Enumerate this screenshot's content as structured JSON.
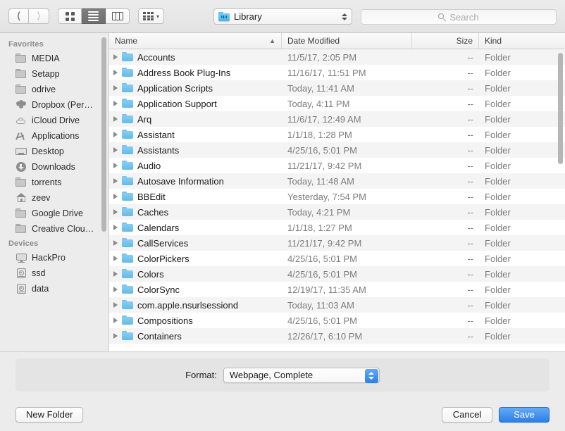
{
  "toolbar": {
    "back_icon": "chevron-left-icon",
    "forward_icon": "chevron-right-icon",
    "view_icon_label": "icon-view",
    "view_list_label": "list-view",
    "view_column_label": "column-view",
    "arrange_label": "arrange-by",
    "path_label": "Library",
    "search_placeholder": "Search",
    "search_value": ""
  },
  "sidebar": {
    "sections": [
      {
        "title": "Favorites",
        "items": [
          {
            "label": "MEDIA",
            "icon": "folder-icon"
          },
          {
            "label": "Setapp",
            "icon": "folder-icon"
          },
          {
            "label": "odrive",
            "icon": "folder-icon"
          },
          {
            "label": "Dropbox (Per…",
            "icon": "dropbox-icon"
          },
          {
            "label": "iCloud Drive",
            "icon": "cloud-icon"
          },
          {
            "label": "Applications",
            "icon": "applications-icon"
          },
          {
            "label": "Desktop",
            "icon": "desktop-icon"
          },
          {
            "label": "Downloads",
            "icon": "downloads-icon"
          },
          {
            "label": "torrents",
            "icon": "folder-icon"
          },
          {
            "label": "zeev",
            "icon": "home-icon"
          },
          {
            "label": "Google Drive",
            "icon": "folder-icon"
          },
          {
            "label": "Creative Clou…",
            "icon": "folder-icon"
          }
        ]
      },
      {
        "title": "Devices",
        "items": [
          {
            "label": "HackPro",
            "icon": "display-icon"
          },
          {
            "label": "ssd",
            "icon": "harddisk-icon"
          },
          {
            "label": "data",
            "icon": "harddisk-icon"
          }
        ]
      }
    ]
  },
  "filelist": {
    "columns": {
      "name": "Name",
      "date_modified": "Date Modified",
      "size": "Size",
      "kind": "Kind"
    },
    "sort_column": "Name",
    "sort_direction": "ascending",
    "sort_glyph": "▲",
    "rows": [
      {
        "name": "Accounts",
        "date": "11/5/17, 2:05 PM",
        "size": "--",
        "kind": "Folder"
      },
      {
        "name": "Address Book Plug-Ins",
        "date": "11/16/17, 11:51 PM",
        "size": "--",
        "kind": "Folder"
      },
      {
        "name": "Application Scripts",
        "date": "Today, 11:41 AM",
        "size": "--",
        "kind": "Folder"
      },
      {
        "name": "Application Support",
        "date": "Today, 4:11 PM",
        "size": "--",
        "kind": "Folder"
      },
      {
        "name": "Arq",
        "date": "11/6/17, 12:49 AM",
        "size": "--",
        "kind": "Folder"
      },
      {
        "name": "Assistant",
        "date": "1/1/18, 1:28 PM",
        "size": "--",
        "kind": "Folder"
      },
      {
        "name": "Assistants",
        "date": "4/25/16, 5:01 PM",
        "size": "--",
        "kind": "Folder"
      },
      {
        "name": "Audio",
        "date": "11/21/17, 9:42 PM",
        "size": "--",
        "kind": "Folder"
      },
      {
        "name": "Autosave Information",
        "date": "Today, 11:48 AM",
        "size": "--",
        "kind": "Folder"
      },
      {
        "name": "BBEdit",
        "date": "Yesterday, 7:54 PM",
        "size": "--",
        "kind": "Folder"
      },
      {
        "name": "Caches",
        "date": "Today, 4:21 PM",
        "size": "--",
        "kind": "Folder"
      },
      {
        "name": "Calendars",
        "date": "1/1/18, 1:27 PM",
        "size": "--",
        "kind": "Folder"
      },
      {
        "name": "CallServices",
        "date": "11/21/17, 9:42 PM",
        "size": "--",
        "kind": "Folder"
      },
      {
        "name": "ColorPickers",
        "date": "4/25/16, 5:01 PM",
        "size": "--",
        "kind": "Folder"
      },
      {
        "name": "Colors",
        "date": "4/25/16, 5:01 PM",
        "size": "--",
        "kind": "Folder"
      },
      {
        "name": "ColorSync",
        "date": "12/19/17, 11:35 AM",
        "size": "--",
        "kind": "Folder"
      },
      {
        "name": "com.apple.nsurlsessiond",
        "date": "Today, 11:03 AM",
        "size": "--",
        "kind": "Folder"
      },
      {
        "name": "Compositions",
        "date": "4/25/16, 5:01 PM",
        "size": "--",
        "kind": "Folder"
      },
      {
        "name": "Containers",
        "date": "12/26/17, 6:10 PM",
        "size": "--",
        "kind": "Folder"
      }
    ]
  },
  "format": {
    "label": "Format:",
    "value": "Webpage, Complete"
  },
  "footer": {
    "new_folder": "New Folder",
    "cancel": "Cancel",
    "save": "Save"
  },
  "colors": {
    "accent": "#2d7ee8",
    "folder_blue": "#62bbe9",
    "window_chrome": "#ececec"
  }
}
